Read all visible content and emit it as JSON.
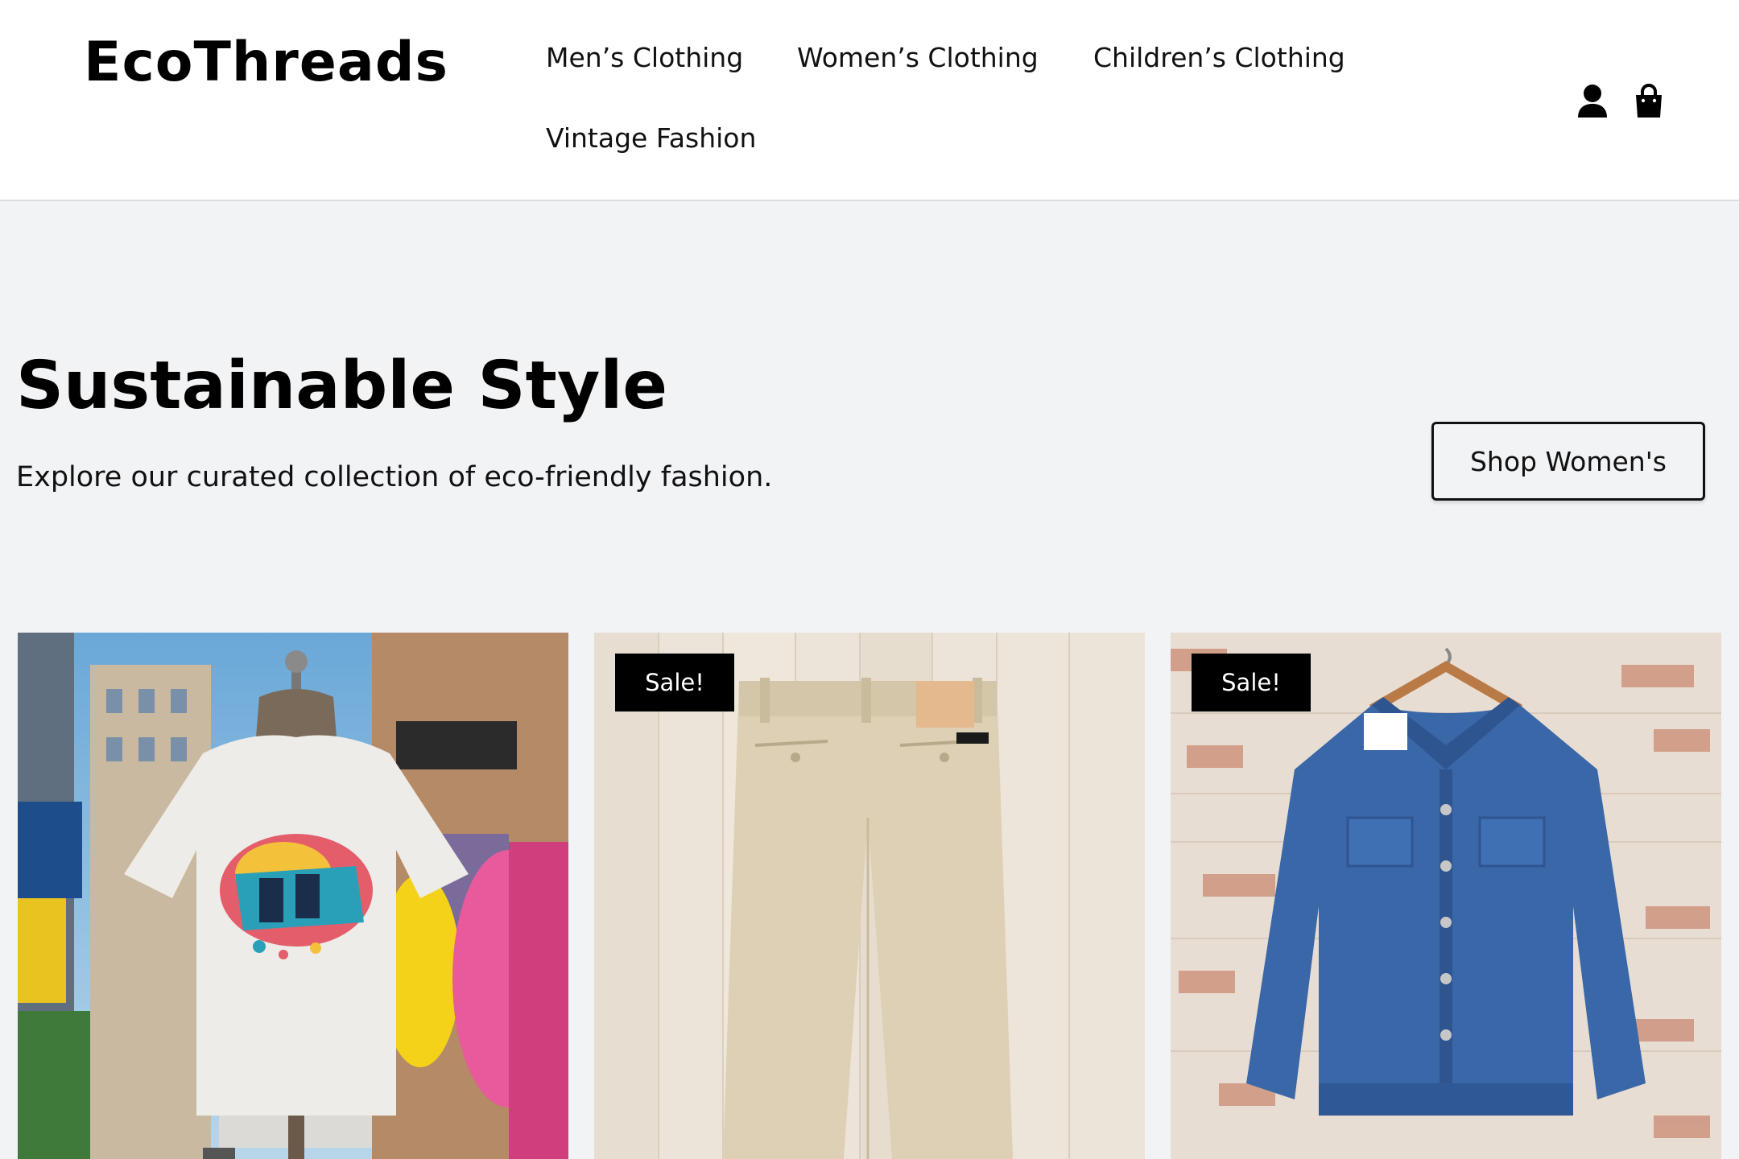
{
  "header": {
    "logo": "EcoThreads",
    "nav": [
      {
        "label": "Men’s Clothing"
      },
      {
        "label": "Women’s Clothing"
      },
      {
        "label": "Children’s Clothing"
      },
      {
        "label": "Vintage Fashion"
      }
    ],
    "icons": [
      "account-icon",
      "shopping-bag-icon"
    ]
  },
  "hero": {
    "title": "Sustainable Style",
    "subtitle": "Explore our curated collection of eco-friendly fashion.",
    "cta_label": "Shop Women's"
  },
  "products": [
    {
      "image": "graphic-tshirt-on-mannequin",
      "badge": ""
    },
    {
      "image": "khaki-trousers",
      "badge": "Sale!"
    },
    {
      "image": "denim-jacket-on-hanger",
      "badge": "Sale!"
    }
  ],
  "colors": {
    "page_background": "#f2f3f5",
    "header_background": "#ffffff",
    "badge_background": "#000000",
    "badge_text": "#ffffff"
  }
}
